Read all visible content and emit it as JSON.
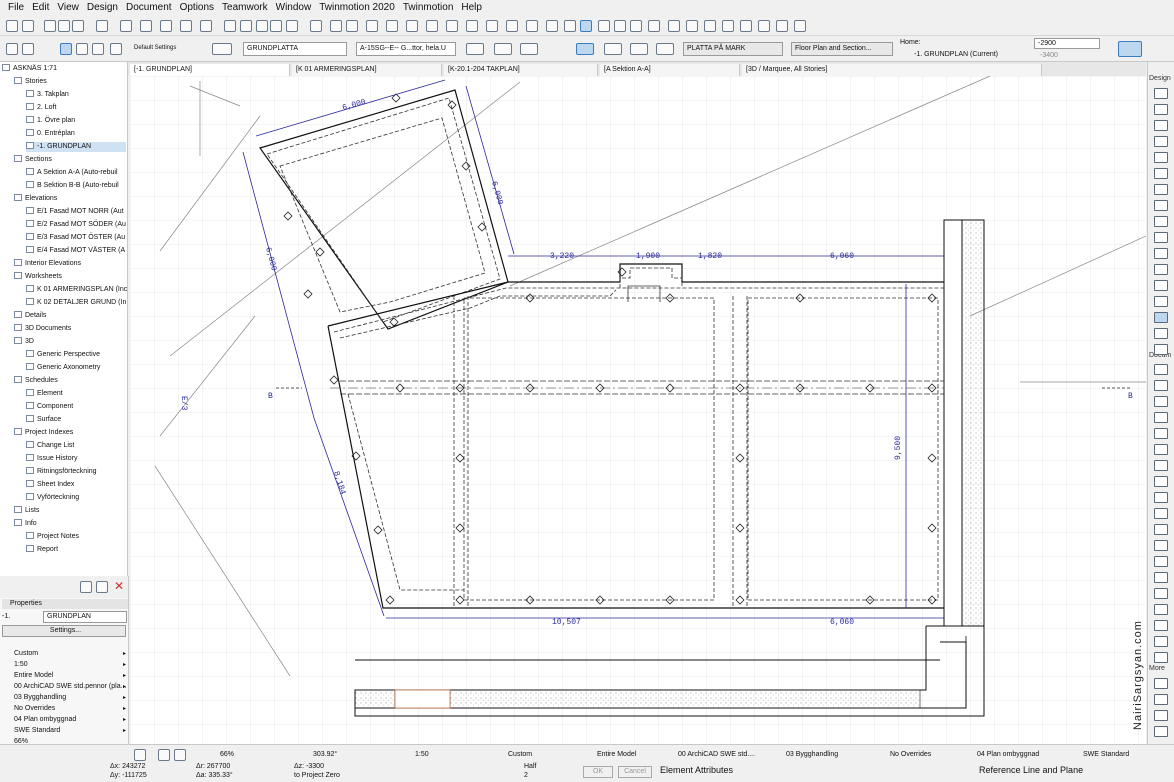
{
  "menu": [
    "File",
    "Edit",
    "View",
    "Design",
    "Document",
    "Options",
    "Teamwork",
    "Window",
    "Twinmotion 2020",
    "Twinmotion",
    "Help"
  ],
  "infobox": {
    "default_settings": "Default Settings",
    "layer": "GRUNDPLATTA",
    "pen_set": "A-15SG--E-- G...ttor, hela.U",
    "structure": "PLATTA PÅ MARK",
    "floor_plan_section": "Floor Plan and Section...",
    "home_label": "Home:",
    "home_value": "-1. GRUNDPLAN (Current)",
    "top_value": "-2900",
    "bottom_value": "-3400"
  },
  "tabs": [
    "[-1. GRUNDPLAN]",
    "[K 01 ARMERINGSPLAN]",
    "[K-20.1-204 TAKPLAN]",
    "[A Sektion A-A]",
    "[3D / Marquee, All Stories]"
  ],
  "navigator": [
    {
      "label": "ASKNÄS 1:71",
      "indent": 0,
      "sel": false
    },
    {
      "label": "Stories",
      "indent": 1,
      "sel": false
    },
    {
      "label": "3. Takplan",
      "indent": 2,
      "sel": false
    },
    {
      "label": "2. Loft",
      "indent": 2,
      "sel": false
    },
    {
      "label": "1. Övre plan",
      "indent": 2,
      "sel": false
    },
    {
      "label": "0. Entréplan",
      "indent": 2,
      "sel": false
    },
    {
      "label": "-1. GRUNDPLAN",
      "indent": 2,
      "sel": true
    },
    {
      "label": "Sections",
      "indent": 1,
      "sel": false
    },
    {
      "label": "A Sektion A-A (Auto-rebuil",
      "indent": 2,
      "sel": false
    },
    {
      "label": "B Sektion B-B (Auto-rebuil",
      "indent": 2,
      "sel": false
    },
    {
      "label": "Elevations",
      "indent": 1,
      "sel": false
    },
    {
      "label": "E/1 Fasad MOT NORR (Aut",
      "indent": 2,
      "sel": false
    },
    {
      "label": "E/2 Fasad MOT SÖDER (Au",
      "indent": 2,
      "sel": false
    },
    {
      "label": "E/3 Fasad MOT ÖSTER (Au",
      "indent": 2,
      "sel": false
    },
    {
      "label": "E/4 Fasad MOT VÄSTER (A",
      "indent": 2,
      "sel": false
    },
    {
      "label": "Interior Elevations",
      "indent": 1,
      "sel": false
    },
    {
      "label": "Worksheets",
      "indent": 1,
      "sel": false
    },
    {
      "label": "K 01 ARMERINGSPLAN (Inc",
      "indent": 2,
      "sel": false
    },
    {
      "label": "K 02 DETALJER GRUND (In",
      "indent": 2,
      "sel": false
    },
    {
      "label": "Details",
      "indent": 1,
      "sel": false
    },
    {
      "label": "3D Documents",
      "indent": 1,
      "sel": false
    },
    {
      "label": "3D",
      "indent": 1,
      "sel": false
    },
    {
      "label": "Generic Perspective",
      "indent": 2,
      "sel": false
    },
    {
      "label": "Generic Axonometry",
      "indent": 2,
      "sel": false
    },
    {
      "label": "Schedules",
      "indent": 1,
      "sel": false
    },
    {
      "label": "Element",
      "indent": 2,
      "sel": false
    },
    {
      "label": "Component",
      "indent": 2,
      "sel": false
    },
    {
      "label": "Surface",
      "indent": 2,
      "sel": false
    },
    {
      "label": "Project Indexes",
      "indent": 1,
      "sel": false
    },
    {
      "label": "Change List",
      "indent": 2,
      "sel": false
    },
    {
      "label": "Issue History",
      "indent": 2,
      "sel": false
    },
    {
      "label": "Ritningsförteckning",
      "indent": 2,
      "sel": false
    },
    {
      "label": "Sheet Index",
      "indent": 2,
      "sel": false
    },
    {
      "label": "Vyförteckning",
      "indent": 2,
      "sel": false
    },
    {
      "label": "Lists",
      "indent": 1,
      "sel": false
    },
    {
      "label": "Info",
      "indent": 1,
      "sel": false
    },
    {
      "label": "Project Notes",
      "indent": 2,
      "sel": false
    },
    {
      "label": "Report",
      "indent": 2,
      "sel": false
    }
  ],
  "properties": {
    "title": "Properties",
    "id": "-1.",
    "name": "GRUNDPLAN",
    "settings_button": "Settings...",
    "rows": [
      "Custom",
      "1:50",
      "Entire Model",
      "00 ArchiCAD SWE std.pennor (pla...",
      "03 Bygghandling",
      "No Overrides",
      "04 Plan ombyggnad",
      "SWE Standard",
      "66%",
      "303.92°"
    ]
  },
  "dimensions": {
    "top_left": "6,000",
    "left_side": "6,000",
    "right_side": "6,000",
    "d1": "3,220",
    "d2": "1,900",
    "d3": "1,820",
    "d4": "6,060",
    "right_vertical": "9,500",
    "bottom_left": "10,507",
    "bottom_right": "6,060",
    "diagonal": "8,184"
  },
  "markers": {
    "left_b": "B",
    "right_b": "B",
    "e3": "E/3"
  },
  "watermark": "NairiSargsyan.com",
  "right_palette": {
    "design": "Design",
    "docum": "Docum",
    "more": "More"
  },
  "status": {
    "zoom": "66%",
    "angle": "303.92°",
    "scale": "1:50",
    "custom": "Custom",
    "model": "Entire Model",
    "pens": "00 ArchiCAD SWE std....",
    "phase": "03 Bygghandling",
    "overrides": "No Overrides",
    "renovation": "04 Plan ombyggnad",
    "standard": "SWE Standard",
    "dx": "Δx: 243272",
    "dy": "Δy: -111725",
    "dr": "Δr: 267700",
    "da": "Δa: 335.33°",
    "dz": "Δz: -3300",
    "to_project_zero": "to Project Zero",
    "half": "Half",
    "half_val": "2",
    "ok": "OK",
    "cancel": "Cancel",
    "element_attributes": "Element Attributes",
    "ref_line": "Reference Line and Plane"
  }
}
